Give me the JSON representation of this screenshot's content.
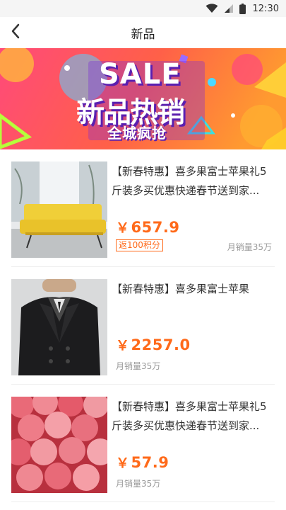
{
  "status_bar": {
    "time": "12:30"
  },
  "nav": {
    "title": "新品"
  },
  "banner": {
    "headline": "SALE",
    "subtitle": "新品热销",
    "tagline": "全城疯抢"
  },
  "colors": {
    "accent": "#ff6a1a",
    "banner_start": "#ff4a7a",
    "banner_end": "#ff9a30"
  },
  "products": [
    {
      "title": "【新春特惠】喜多果富士苹果礼5斤装多买优惠快递春节送到家...",
      "currency": "￥",
      "price": "657.9",
      "points_badge": "返100积分",
      "sales": "月销量35万",
      "image": "yellow-sofa"
    },
    {
      "title": "【新春特惠】喜多果富士苹果",
      "currency": "￥",
      "price": "2257.0",
      "sales": "月销量35万",
      "image": "black-coat"
    },
    {
      "title": "【新春特惠】喜多果富士苹果礼5斤装多买优惠快递春节送到家...",
      "currency": "￥",
      "price": "57.9",
      "sales": "月销量35万",
      "image": "red-apples"
    }
  ]
}
